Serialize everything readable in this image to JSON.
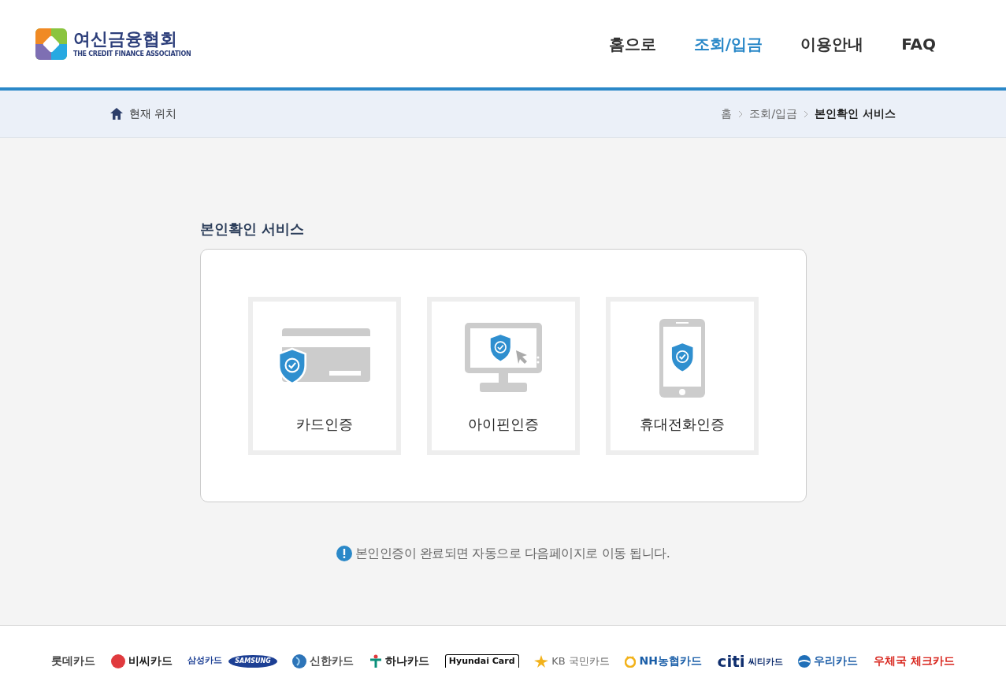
{
  "logo": {
    "name": "여신금융협회",
    "subtitle": "THE CREDIT FINANCE ASSOCIATION"
  },
  "nav": [
    {
      "label": "홈으로",
      "selected": false
    },
    {
      "label": "조회/입금",
      "selected": true
    },
    {
      "label": "이용안내",
      "selected": false
    },
    {
      "label": "FAQ",
      "selected": false
    }
  ],
  "location": {
    "label": "현재 위치",
    "breadcrumb": [
      "홈",
      "조회/입금",
      "본인확인 서비스"
    ]
  },
  "section_title": "본인확인 서비스",
  "methods": [
    {
      "kind": "card",
      "label": "카드인증"
    },
    {
      "kind": "ipin",
      "label": "아이핀인증"
    },
    {
      "kind": "phone",
      "label": "휴대전화인증"
    }
  ],
  "notice": "본인인증이 완료되면 자동으로 다음페이지로 이동 됩니다.",
  "partners": [
    {
      "kind": "plain",
      "text": "롯데카드",
      "color": "#444444"
    },
    {
      "kind": "bc",
      "text": "비씨카드",
      "color": "#222222"
    },
    {
      "kind": "samsung",
      "text": "삼성카드",
      "badge": "SAMSUNG",
      "color": "#1c3f94"
    },
    {
      "kind": "shinhan",
      "text": "신한카드",
      "color": "#555555"
    },
    {
      "kind": "hana",
      "text": "하나카드",
      "color": "#222222"
    },
    {
      "kind": "boxed",
      "text": "Hyundai Card",
      "color": "#111111"
    },
    {
      "kind": "kb",
      "text": "KB 국민카드",
      "color": "#666666"
    },
    {
      "kind": "nh",
      "text": "NH농협카드",
      "color": "#1a5ea8"
    },
    {
      "kind": "citi",
      "badge": "citi",
      "text": "씨티카드",
      "color": "#0f2e6e"
    },
    {
      "kind": "woori",
      "text": "우리카드",
      "color": "#1f5fa8"
    },
    {
      "kind": "plain",
      "text": "우체국 체크카드",
      "color": "#d8251d"
    }
  ]
}
